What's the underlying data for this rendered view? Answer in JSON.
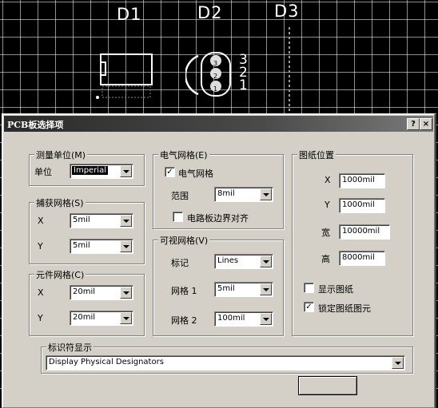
{
  "pcb": {
    "designators": [
      "D1",
      "D2",
      "D3"
    ],
    "pin_numbers": [
      "3",
      "2",
      "1"
    ],
    "pad_numbers": [
      "3",
      "2",
      "1"
    ]
  },
  "dialog": {
    "title": "PCB板选择项",
    "help_label": "?",
    "close_label": "×",
    "units_group": {
      "label": "测量单位(M)",
      "unit_label": "单位",
      "unit_value": "Imperial"
    },
    "snap_group": {
      "label": "捕获网格(S)",
      "x_label": "X",
      "x_value": "5mil",
      "y_label": "Y",
      "y_value": "5mil"
    },
    "component_group": {
      "label": "元件网格(C)",
      "x_label": "X",
      "x_value": "20mil",
      "y_label": "Y",
      "y_value": "20mil"
    },
    "electrical_group": {
      "label": "电气网格(E)",
      "enable_label": "电气网格",
      "enable_checked": true,
      "range_label": "范围",
      "range_value": "8mil",
      "board_align_label": "电路板边界对齐",
      "board_align_checked": false
    },
    "visible_group": {
      "label": "可视网格(V)",
      "marker_label": "标记",
      "marker_value": "Lines",
      "grid1_label": "网格 1",
      "grid1_value": "5mil",
      "grid2_label": "网格 2",
      "grid2_value": "100mil"
    },
    "sheet_group": {
      "label": "图纸位置",
      "x_label": "X",
      "x_value": "1000mil",
      "y_label": "Y",
      "y_value": "1000mil",
      "width_label": "宽",
      "width_value": "10000mil",
      "height_label": "高",
      "height_value": "8000mil",
      "show_sheet_label": "显示图纸",
      "show_sheet_checked": false,
      "lock_sheet_label": "锁定图纸图元",
      "lock_sheet_checked": true
    },
    "designator_group": {
      "label": "标识符显示",
      "value": "Display Physical Designators"
    }
  },
  "colors": {
    "pcb_background": "#000000",
    "dialog_face": "#d4d0c8",
    "titlebar": "#3a3a3a"
  }
}
